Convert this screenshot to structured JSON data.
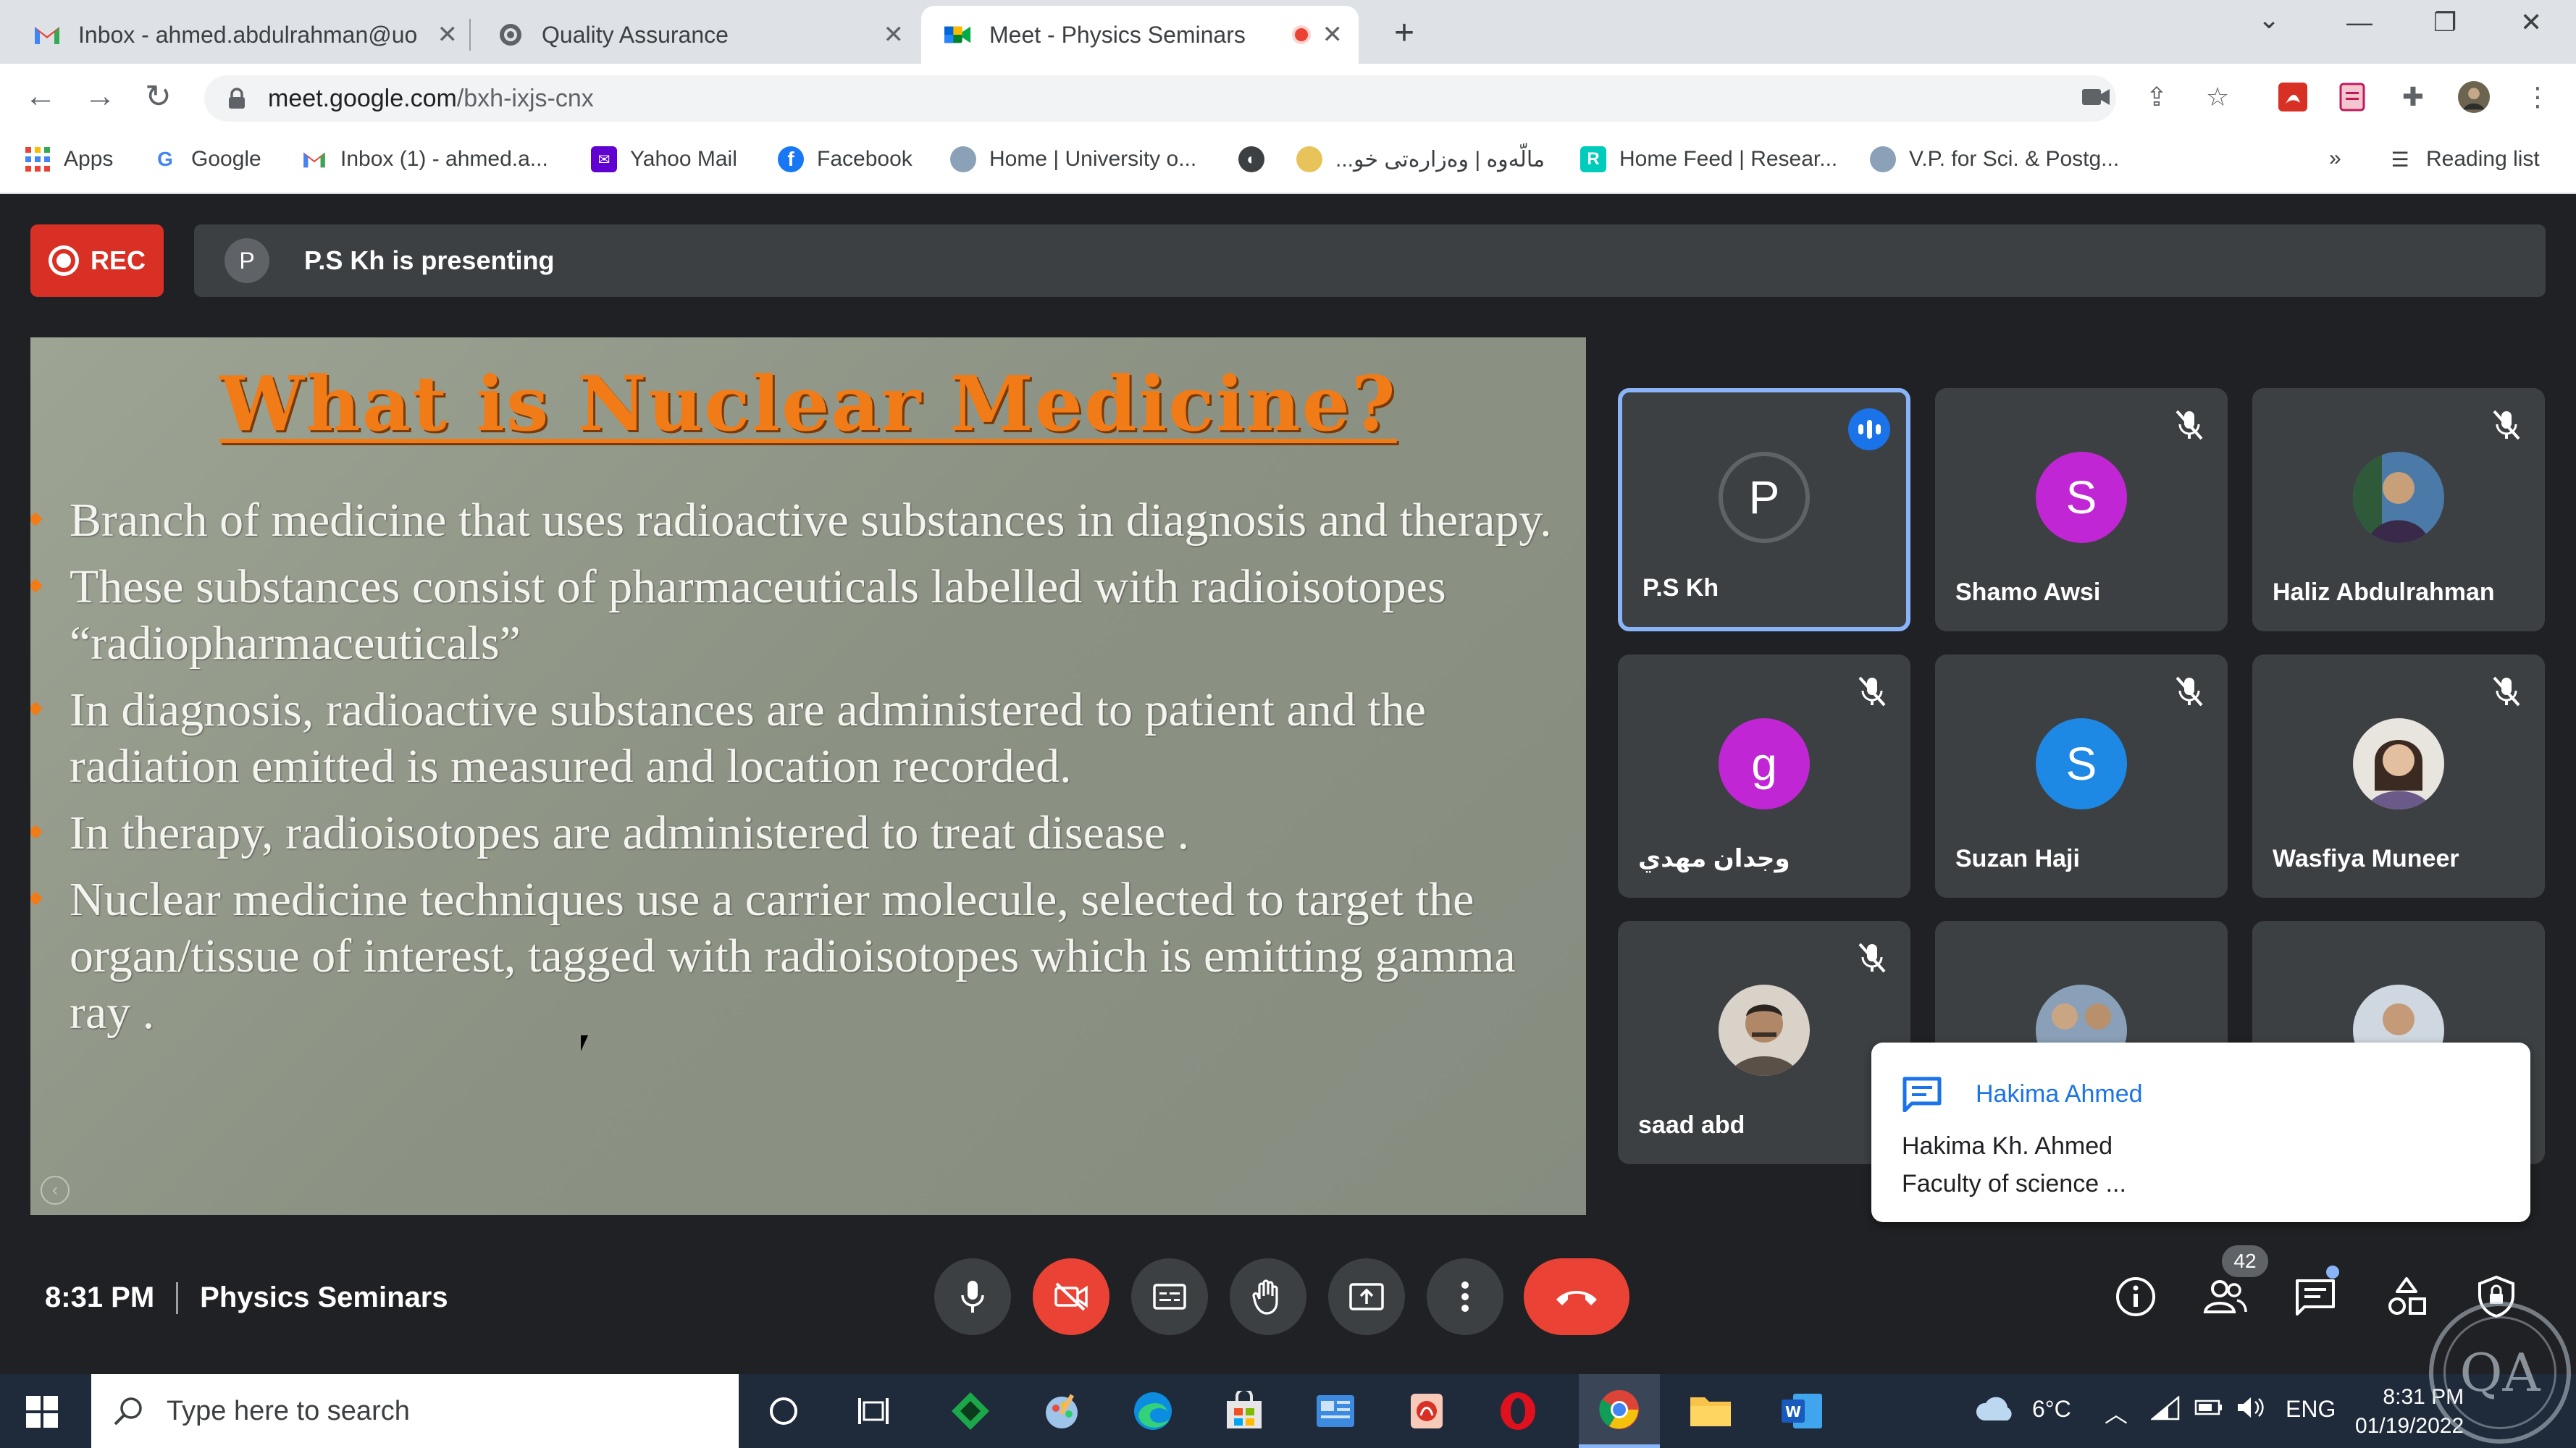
{
  "browser": {
    "tabs": [
      {
        "title": "Inbox - ahmed.abdulrahman@uo",
        "favicon": "gmail-icon"
      },
      {
        "title": "Quality Assurance",
        "favicon": "globe-icon"
      },
      {
        "title": "Meet - Physics Seminars",
        "favicon": "meet-icon",
        "recording": true
      }
    ],
    "url_host": "meet.google.com",
    "url_path": "/bxh-ixjs-cnx",
    "bookmarks": [
      {
        "label": "Apps",
        "icon": "apps-grid-icon"
      },
      {
        "label": "Google",
        "icon": "google-icon"
      },
      {
        "label": "Inbox (1) - ahmed.a...",
        "icon": "gmail-icon"
      },
      {
        "label": "Yahoo Mail",
        "icon": "yahoo-mail-icon"
      },
      {
        "label": "Facebook",
        "icon": "facebook-icon"
      },
      {
        "label": "Home | University o...",
        "icon": "university-icon"
      },
      {
        "label": "",
        "icon": "globe-icon"
      },
      {
        "label": "...مالّەوە | وەزارەتی خو",
        "icon": "ministry-icon"
      },
      {
        "label": "Home Feed | Resear...",
        "icon": "researchgate-icon"
      },
      {
        "label": "V.P. for Sci. & Postg...",
        "icon": "university-icon"
      }
    ],
    "more_label": "»",
    "reading_list": "Reading list"
  },
  "meet": {
    "rec_label": "REC",
    "presenter_initial": "P",
    "presenting_text": "P.S Kh is presenting",
    "slide": {
      "title": "What is Nuclear Medicine?",
      "bullets": [
        "Branch of medicine that uses radioactive substances in diagnosis and therapy.",
        "These substances consist of pharmaceuticals labelled with radioisotopes “radiopharmaceuticals”",
        "In diagnosis, radioactive substances are administered to patient and the radiation emitted is measured and location recorded.",
        "In therapy, radioisotopes are administered to treat disease .",
        "Nuclear medicine techniques use a carrier molecule, selected to target the organ/tissue of interest, tagged with radioisotopes which is emitting gamma ray ."
      ]
    },
    "participants": [
      {
        "name": "P.S Kh",
        "initial": "P",
        "color": "#3c4043"
      },
      {
        "name": "Shamo Awsi",
        "initial": "S",
        "color": "#c026d3"
      },
      {
        "name": "Haliz Abdulrahman",
        "initial": "",
        "color": "#7b8ba0"
      },
      {
        "name": "وجدان مهدي",
        "initial": "g",
        "color": "#c026d3"
      },
      {
        "name": "Suzan Haji",
        "initial": "S",
        "color": "#1e88e5"
      },
      {
        "name": "Wasfiya Muneer",
        "initial": "",
        "color": "#b0a090"
      },
      {
        "name": "saad abd",
        "initial": "",
        "color": "#8a7a6a"
      }
    ],
    "chat_toast": {
      "sender": "Hakima Ahmed",
      "line1": "Hakima Kh. Ahmed",
      "line2": "Faculty of science ..."
    },
    "time": "8:31 PM",
    "meeting_name": "Physics Seminars",
    "participant_count": "42"
  },
  "taskbar": {
    "search_placeholder": "Type here to search",
    "weather": "6°C",
    "language": "ENG",
    "time": "8:31 PM",
    "date": "01/19/2022"
  }
}
